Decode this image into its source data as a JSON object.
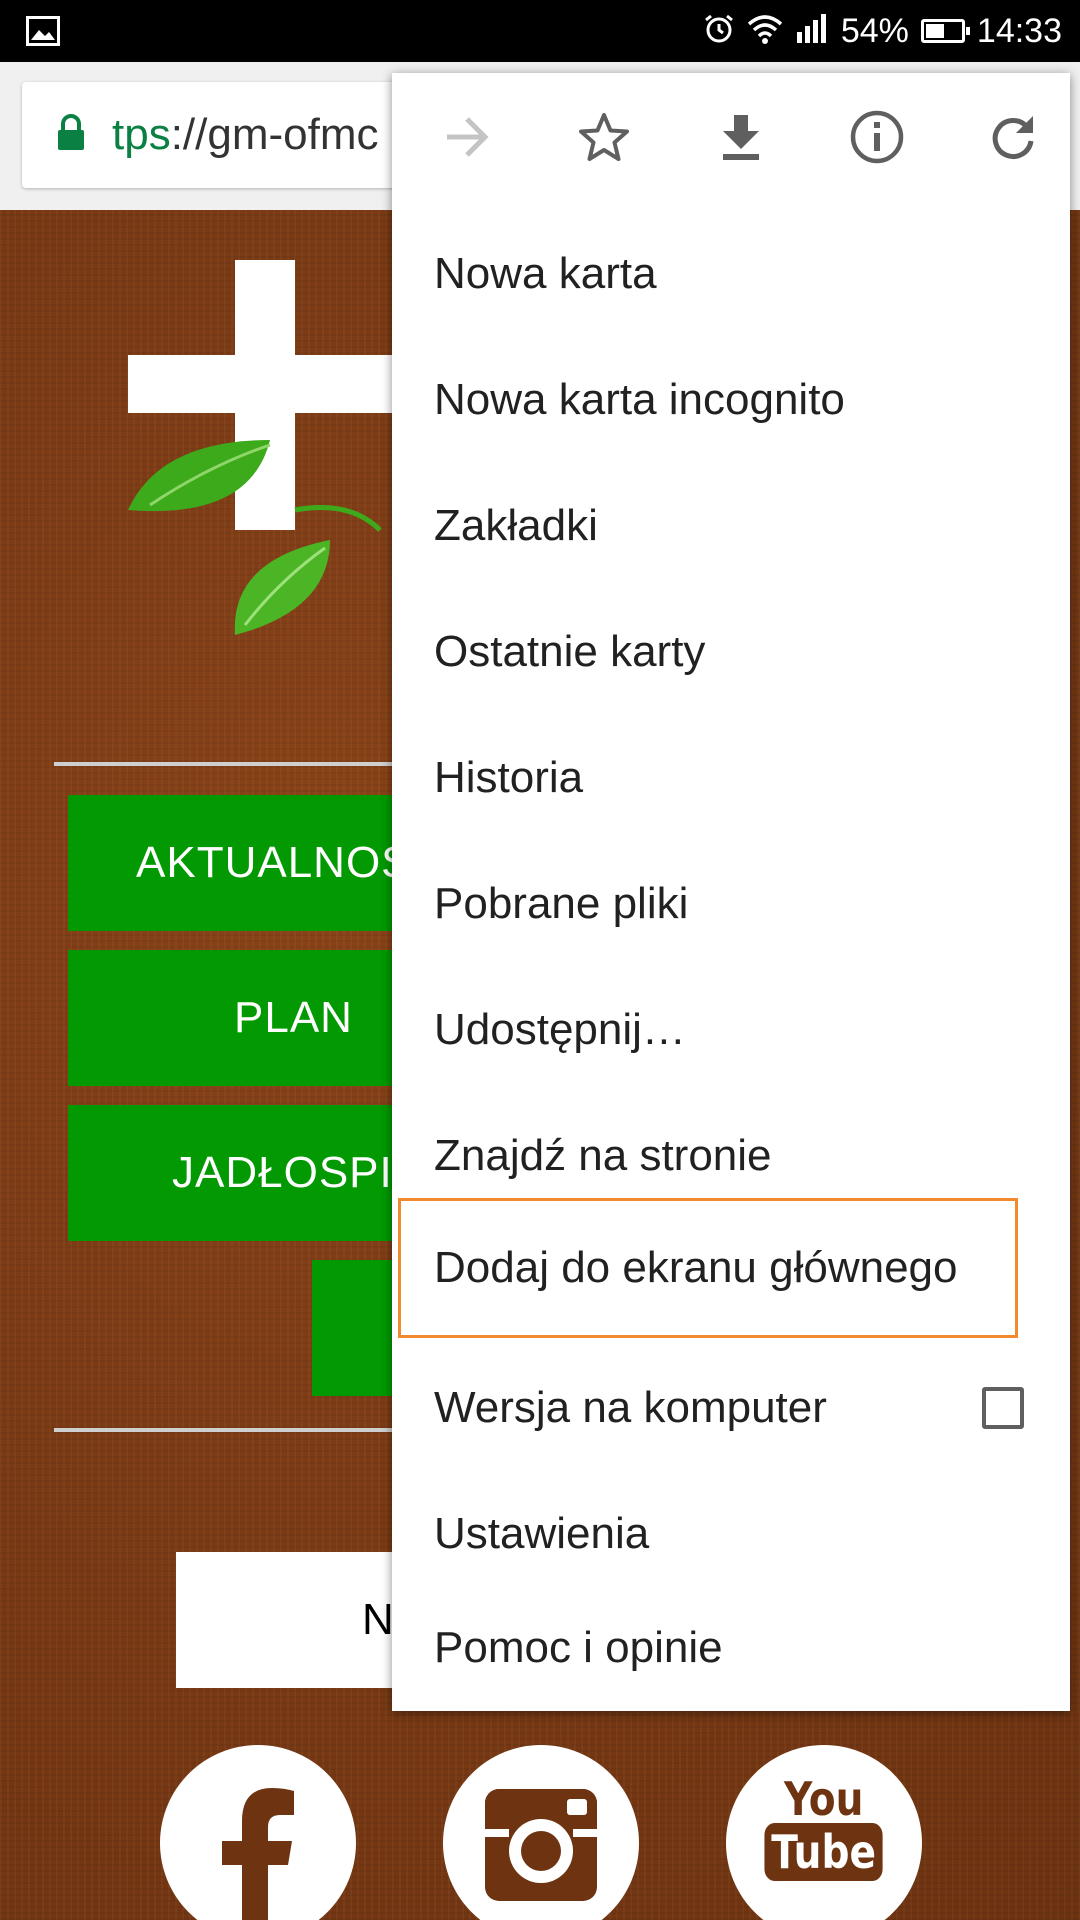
{
  "status_bar": {
    "battery_percent": "54%",
    "time": "14:33",
    "battery_level": 0.54,
    "icons": [
      "gallery-icon",
      "alarm-icon",
      "wifi-icon",
      "signal-icon",
      "battery-icon"
    ]
  },
  "browser": {
    "url_scheme": "tps",
    "url_rest": "://gm-ofmc"
  },
  "page": {
    "buttons": {
      "news": "AKTUALNOŚ",
      "plan": "PLAN",
      "menu": "JADŁOSPI",
      "white": "N"
    },
    "social": [
      "facebook-icon",
      "instagram-icon",
      "youtube-icon"
    ],
    "youtube_you": "You",
    "youtube_tube": "Tube",
    "colors": {
      "green": "#029902",
      "wood": "#7a3a14",
      "highlight": "#f08a2c",
      "secure_green": "#0b8043"
    }
  },
  "menu": {
    "icons": [
      "forward-icon",
      "bookmark-star-icon",
      "download-icon",
      "info-icon",
      "refresh-icon"
    ],
    "items": [
      {
        "label": "Nowa karta"
      },
      {
        "label": "Nowa karta incognito"
      },
      {
        "label": "Zakładki"
      },
      {
        "label": "Ostatnie karty"
      },
      {
        "label": "Historia"
      },
      {
        "label": "Pobrane pliki"
      },
      {
        "label": "Udostępnij…"
      },
      {
        "label": "Znajdź na stronie"
      },
      {
        "label": "Dodaj do ekranu głównego",
        "highlighted": true
      },
      {
        "label": "Wersja na komputer",
        "checkbox": false
      },
      {
        "label": "Ustawienia"
      },
      {
        "label": "Pomoc i opinie"
      }
    ]
  }
}
